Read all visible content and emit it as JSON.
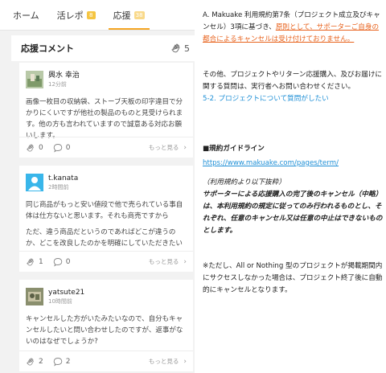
{
  "tabs": [
    {
      "label": "ホーム",
      "badge": ""
    },
    {
      "label": "活レポ",
      "badge": "8"
    },
    {
      "label": "応援",
      "badge": "38"
    }
  ],
  "section": {
    "title": "応援コメント",
    "count": "5"
  },
  "comments": [
    {
      "user": "興水 幸治",
      "time": "12分前",
      "paragraphs": [
        "画像一枚目の収納袋、ストーブ天板の印字違目で分かりにくいですが他社の製品のものと見受けられます。他の方も言われていますので誠意ある対応お願いします。"
      ],
      "likes": "0",
      "replies": "0",
      "more": "もっと見る"
    },
    {
      "user": "t.kanata",
      "time": "2時間前",
      "paragraphs": [
        "同じ商品がもっと安い値段で他で売られている事自体は仕方ないと思います。それも商売ですから",
        "ただ、違う商品だというのであればどこが違うのか、どこを改良したのかを明確にしていただきたい"
      ],
      "likes": "1",
      "replies": "0",
      "more": "もっと見る"
    },
    {
      "user": "yatsute21",
      "time": "10時間前",
      "paragraphs": [
        "キャンセルした方がいたみたいなので、自分もキャンセルしたいと問い合わせしたのですが、返事がないのはなぜでしょうか?"
      ],
      "likes": "2",
      "replies": "2",
      "more": "もっと見る"
    }
  ],
  "right": {
    "p1_lead": "A. Makuake 利用規約第7条（プロジェクト成立及びキャンセル）3項に基づき、",
    "p1_emph": "原則として、サポーターご自身の都合によるキャンセルは受け付けておりません。",
    "p2": "その他、プロジェクトやリターン応援購入、及びお届けに関する質問は、実行者へお問い合わせください。",
    "p2_link": "5-2. プロジェクトについて質問がしたい",
    "guide_title": "■規約ガイドライン",
    "guide_url": "https://www.makuake.com/pages/term/",
    "excerpt_head": "（利用規約より以下抜粋）",
    "excerpt_body": "サポーターによる応援購入の完了後のキャンセル（中略）は、本利用規約の規定に従ってのみ行われるものとし、それぞれ、任意のキャンセル又は任意の中止はできないものとします。",
    "note": "※ただし、All or Nothing 型のプロジェクトが掲載期間内にサクセスしなかった場合は、プロジェクト終了後に自動的にキャンセルとなります。"
  },
  "colors": {
    "tab_underline": "#f5a623",
    "badge": "#f5c542",
    "link_orange": "#e8621c",
    "link_blue": "#1e8fd6"
  }
}
